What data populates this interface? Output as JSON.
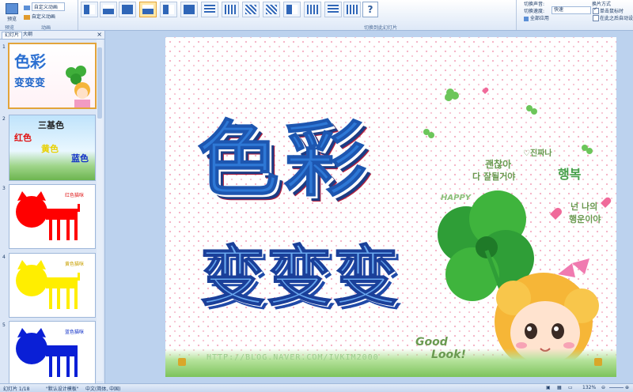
{
  "ribbon": {
    "preview_label": "预览",
    "group_preview": "预览",
    "custom_anim_label": "自定义动画",
    "anim_dropdown": "自定义动画",
    "group_anim": "动画",
    "group_transition": "切换到此幻灯片",
    "transition_sound_label": "切换声音:",
    "transition_speed_label": "切换速度:",
    "transition_speed_value": "快速",
    "apply_all_label": "全部应用",
    "advance_label": "换片方式",
    "on_click_label": "单击鼠标时",
    "auto_after_label": "在此之后自动设置",
    "help_label": "?"
  },
  "panel": {
    "tab_slides": "幻灯片",
    "tab_outline": "大纲",
    "close": "×",
    "thumbs": [
      {
        "num": "1",
        "line1": "色彩",
        "line2": "变变变"
      },
      {
        "num": "2",
        "title": "三基色",
        "red": "红色",
        "yellow": "黄色",
        "blue": "蓝色"
      },
      {
        "num": "3",
        "label": "红色猫咪",
        "color": "#ff0000"
      },
      {
        "num": "4",
        "label": "黄色猫咪",
        "color": "#ffee00"
      },
      {
        "num": "5",
        "label": "蓝色猫咪",
        "color": "#0a1fd6"
      }
    ]
  },
  "slide": {
    "title": "色彩",
    "subtitle": "变变变",
    "url": "HTTP://BLOG.NAVER.COM/IVKIM2000",
    "deco": {
      "k1": "괜찮아",
      "k2": "다 잘될거야",
      "k3": "♡진짜나",
      "k4": "행복",
      "k5": "넌 나의",
      "k6": "행운이야",
      "happy": "HAPPY",
      "good": "Good",
      "look": "Look!"
    }
  },
  "status": {
    "slide_info": "幻灯片 1/18",
    "theme": "\"默认设计模板\"",
    "lang": "中文(简体, 中国)",
    "zoom": "132%"
  },
  "colors": {
    "accent": "#2e78d6",
    "selection": "#e3a43a"
  }
}
